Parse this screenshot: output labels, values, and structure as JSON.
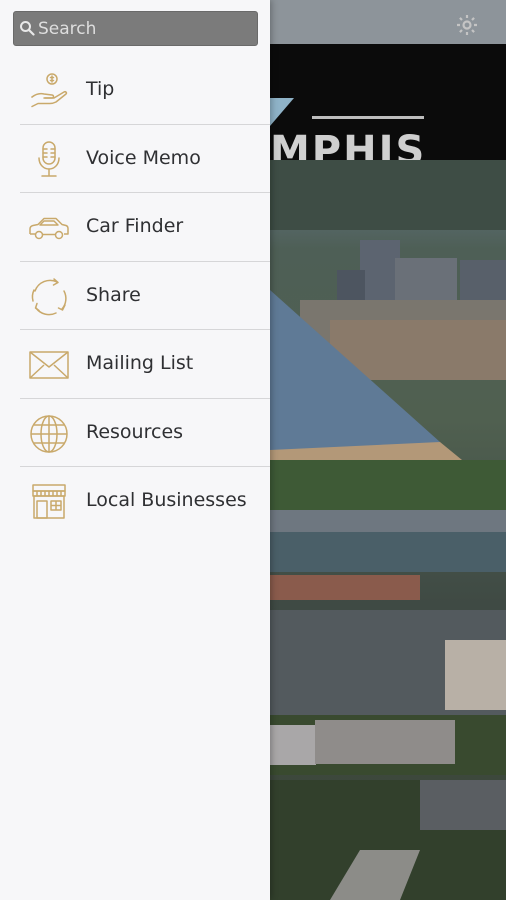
{
  "background": {
    "banner_text": "MPHIS"
  },
  "drawer": {
    "search": {
      "placeholder": "Search",
      "value": ""
    },
    "items": [
      {
        "label": "Tip",
        "icon": "tip-hand-icon"
      },
      {
        "label": "Voice Memo",
        "icon": "microphone-icon"
      },
      {
        "label": "Car Finder",
        "icon": "car-icon"
      },
      {
        "label": "Share",
        "icon": "share-refresh-icon"
      },
      {
        "label": "Mailing List",
        "icon": "envelope-icon"
      },
      {
        "label": "Resources",
        "icon": "globe-icon"
      },
      {
        "label": "Local Businesses",
        "icon": "storefront-icon"
      }
    ]
  },
  "colors": {
    "icon_gold": "#c9a96b",
    "drawer_bg": "#f7f7f9",
    "search_bg": "#7b7b7b",
    "banner_bg": "#0b0b0b"
  }
}
